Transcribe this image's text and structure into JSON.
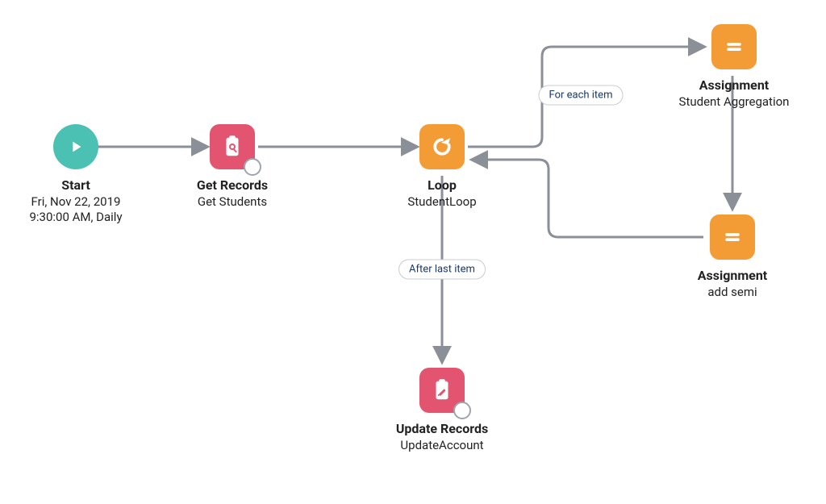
{
  "palette": {
    "start": "#4bc1b3",
    "data": "#e2546f",
    "logic": "#f39c36",
    "connector": "#8b8f98",
    "pillBorder": "#c8ccd4",
    "pillText": "#1b3a6b"
  },
  "labels": {
    "forEach": "For each item",
    "afterLast": "After last item"
  },
  "nodes": {
    "start": {
      "type": "start",
      "title": "Start",
      "sub1": "Fri, Nov 22, 2019",
      "sub2": "9:30:00 AM, Daily",
      "icon": "play-icon"
    },
    "getRecords": {
      "type": "data",
      "title": "Get Records",
      "sub1": "Get Students",
      "icon": "clipboard-search-icon"
    },
    "loop": {
      "type": "logic",
      "title": "Loop",
      "sub1": "StudentLoop",
      "icon": "refresh-icon"
    },
    "assignment1": {
      "type": "logic",
      "title": "Assignment",
      "sub1": "Student Aggregation",
      "icon": "equals-icon"
    },
    "assignment2": {
      "type": "logic",
      "title": "Assignment",
      "sub1": "add semi",
      "icon": "equals-icon"
    },
    "updateRecords": {
      "type": "data",
      "title": "Update Records",
      "sub1": "UpdateAccount",
      "icon": "clipboard-pencil-icon"
    }
  },
  "edges": [
    {
      "from": "start",
      "to": "getRecords"
    },
    {
      "from": "getRecords",
      "to": "loop"
    },
    {
      "from": "loop",
      "to": "assignment1",
      "label": "forEach"
    },
    {
      "from": "assignment1",
      "to": "assignment2"
    },
    {
      "from": "assignment2",
      "to": "loop"
    },
    {
      "from": "loop",
      "to": "updateRecords",
      "label": "afterLast"
    }
  ]
}
